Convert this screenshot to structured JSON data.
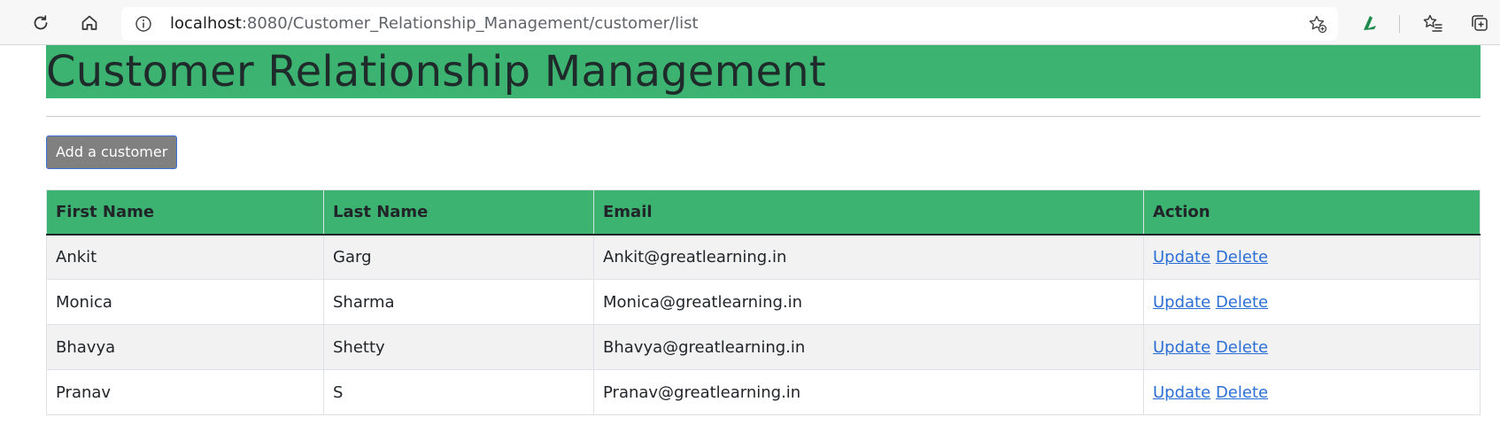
{
  "browser": {
    "url_host": "localhost",
    "url_rest": ":8080/Customer_Relationship_Management/customer/list",
    "icons": [
      "reload-icon",
      "home-icon",
      "info-icon",
      "favorite-add-icon",
      "extension-icon",
      "favorites-icon",
      "collections-icon"
    ]
  },
  "page": {
    "title": "Customer Relationship Management",
    "add_button_label": "Add a customer",
    "accent_color": "#3cb371"
  },
  "table": {
    "headers": [
      "First Name",
      "Last Name",
      "Email",
      "Action"
    ],
    "rows": [
      {
        "first_name": "Ankit",
        "last_name": "Garg",
        "email": "Ankit@greatlearning.in",
        "update": "Update",
        "delete": "Delete"
      },
      {
        "first_name": "Monica",
        "last_name": "Sharma",
        "email": "Monica@greatlearning.in",
        "update": "Update",
        "delete": "Delete"
      },
      {
        "first_name": "Bhavya",
        "last_name": "Shetty",
        "email": "Bhavya@greatlearning.in",
        "update": "Update",
        "delete": "Delete"
      },
      {
        "first_name": "Pranav",
        "last_name": "S",
        "email": "Pranav@greatlearning.in",
        "update": "Update",
        "delete": "Delete"
      }
    ]
  }
}
